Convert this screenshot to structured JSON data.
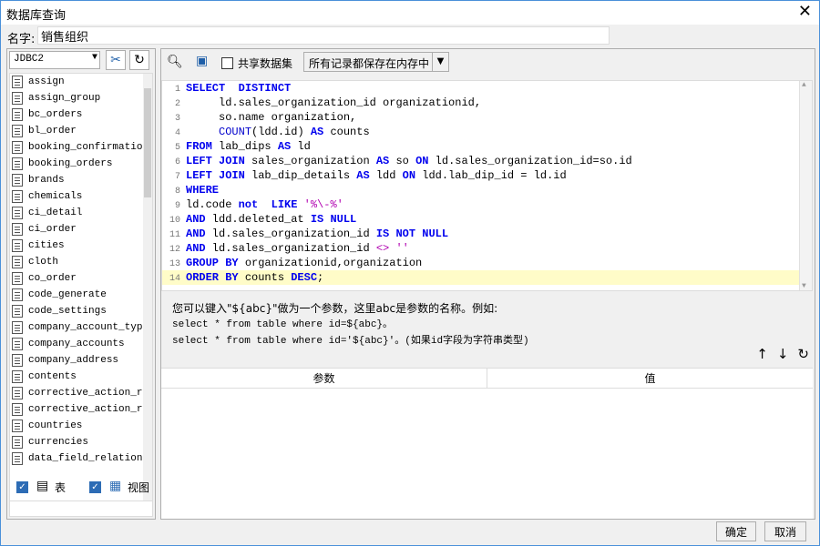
{
  "window": {
    "title": "数据库查询"
  },
  "name_row": {
    "label": "名字:",
    "value": "销售组织"
  },
  "left": {
    "connection": "JDBC2",
    "tables": [
      "assign",
      "assign_group",
      "bc_orders",
      "bl_order",
      "booking_confirmation",
      "booking_orders",
      "brands",
      "chemicals",
      "ci_detail",
      "ci_order",
      "cities",
      "cloth",
      "co_order",
      "code_generate",
      "code_settings",
      "company_account_types",
      "company_accounts",
      "company_address",
      "contents",
      "corrective_action_rep",
      "corrective_action_rep",
      "countries",
      "currencies",
      "data_field_relations"
    ],
    "opt_table_label": "表",
    "opt_view_label": "视图"
  },
  "toolbar": {
    "shared_dataset_label": "共享数据集",
    "storage_option": "所有记录都保存在内存中"
  },
  "sql": {
    "lines": [
      "SELECT  DISTINCT",
      "     ld.sales_organization_id organizationid,",
      "     so.name organization,",
      "     COUNT(ldd.id) AS counts",
      "FROM lab_dips AS ld",
      "LEFT JOIN sales_organization AS so ON ld.sales_organization_id=so.id",
      "LEFT JOIN lab_dip_details AS ldd ON ldd.lab_dip_id = ld.id",
      "WHERE",
      "ld.code not  LIKE '%\\-%'",
      "AND ldd.deleted_at IS NULL",
      "AND ld.sales_organization_id IS NOT NULL",
      "AND ld.sales_organization_id <> ''",
      "GROUP BY organizationid,organization",
      "ORDER BY counts DESC;"
    ]
  },
  "hint": {
    "line1": "您可以键入\"${abc}\"做为一个参数，这里abc是参数的名称。例如:",
    "line2": "select * from table where id=${abc}。",
    "line3": "select * from table where id='${abc}'。(如果id字段为字符串类型)"
  },
  "params_table": {
    "col_param": "参数",
    "col_value": "值"
  },
  "footer": {
    "ok": "确定",
    "cancel": "取消"
  }
}
